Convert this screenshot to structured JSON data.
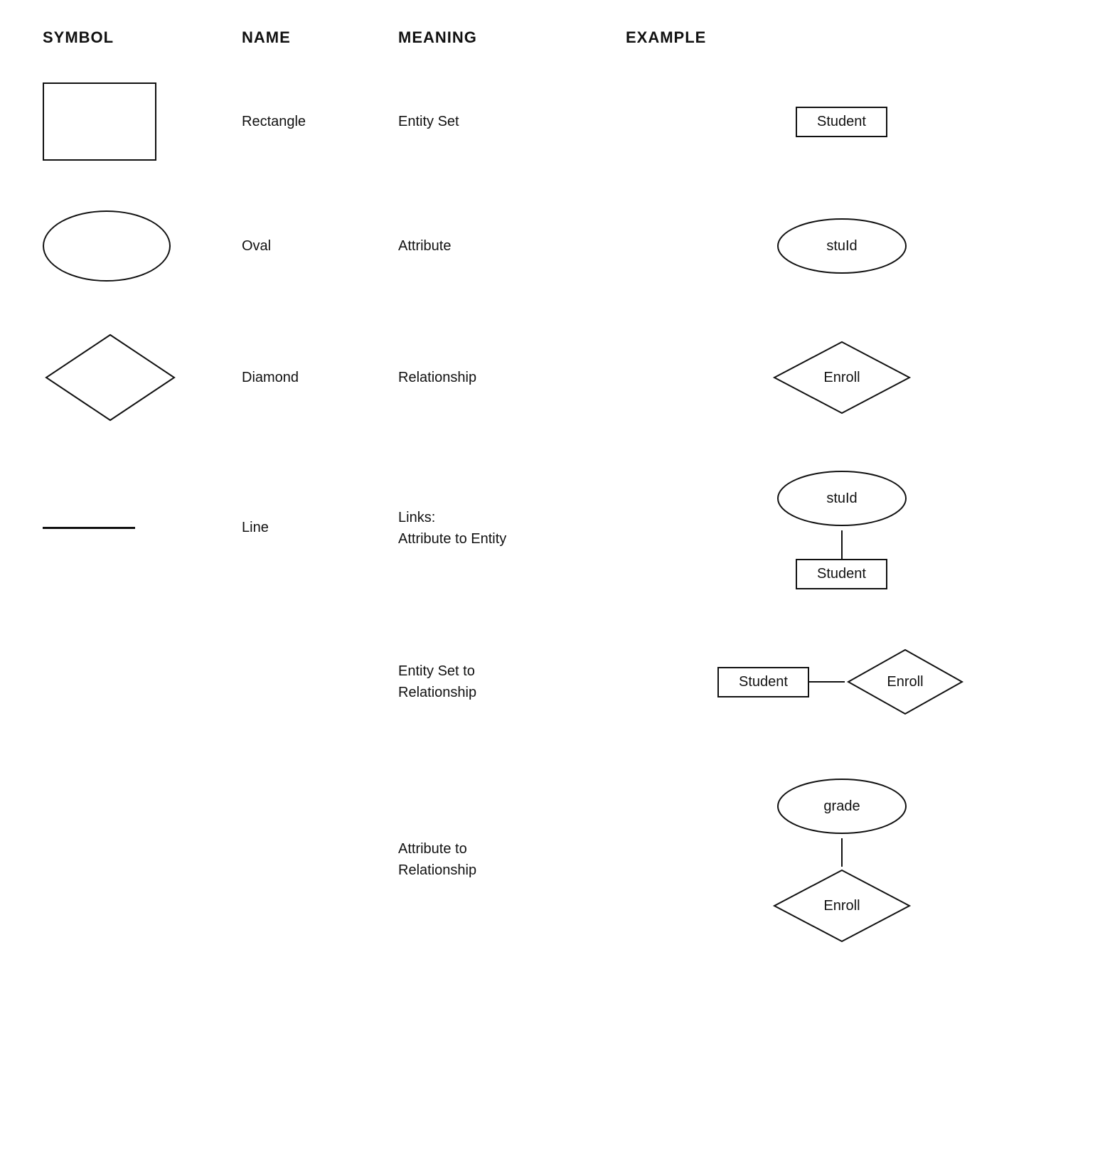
{
  "header": {
    "col1": "SYMBOL",
    "col2": "NAME",
    "col3": "MEANING",
    "col4": "EXAMPLE"
  },
  "rows": [
    {
      "id": "rectangle",
      "symbol": "rectangle",
      "name": "Rectangle",
      "meaning": "Entity Set",
      "example_label": "Student"
    },
    {
      "id": "oval",
      "symbol": "oval",
      "name": "Oval",
      "meaning": "Attribute",
      "example_label": "stuId"
    },
    {
      "id": "diamond",
      "symbol": "diamond",
      "name": "Diamond",
      "meaning": "Relationship",
      "example_label": "Enroll"
    },
    {
      "id": "line",
      "symbol": "line",
      "name": "Line",
      "meaning_line1": "Links:",
      "meaning_line2": "Attribute to Entity",
      "example_oval": "stuId",
      "example_rect": "Student"
    }
  ],
  "extra_rows": [
    {
      "id": "entity-set-to-relationship",
      "meaning_line1": "Entity Set to",
      "meaning_line2": "Relationship",
      "example_rect": "Student",
      "example_diamond": "Enroll"
    },
    {
      "id": "attribute-to-relationship",
      "meaning_line1": "Attribute to",
      "meaning_line2": "Relationship",
      "example_oval": "grade",
      "example_diamond": "Enroll"
    }
  ]
}
